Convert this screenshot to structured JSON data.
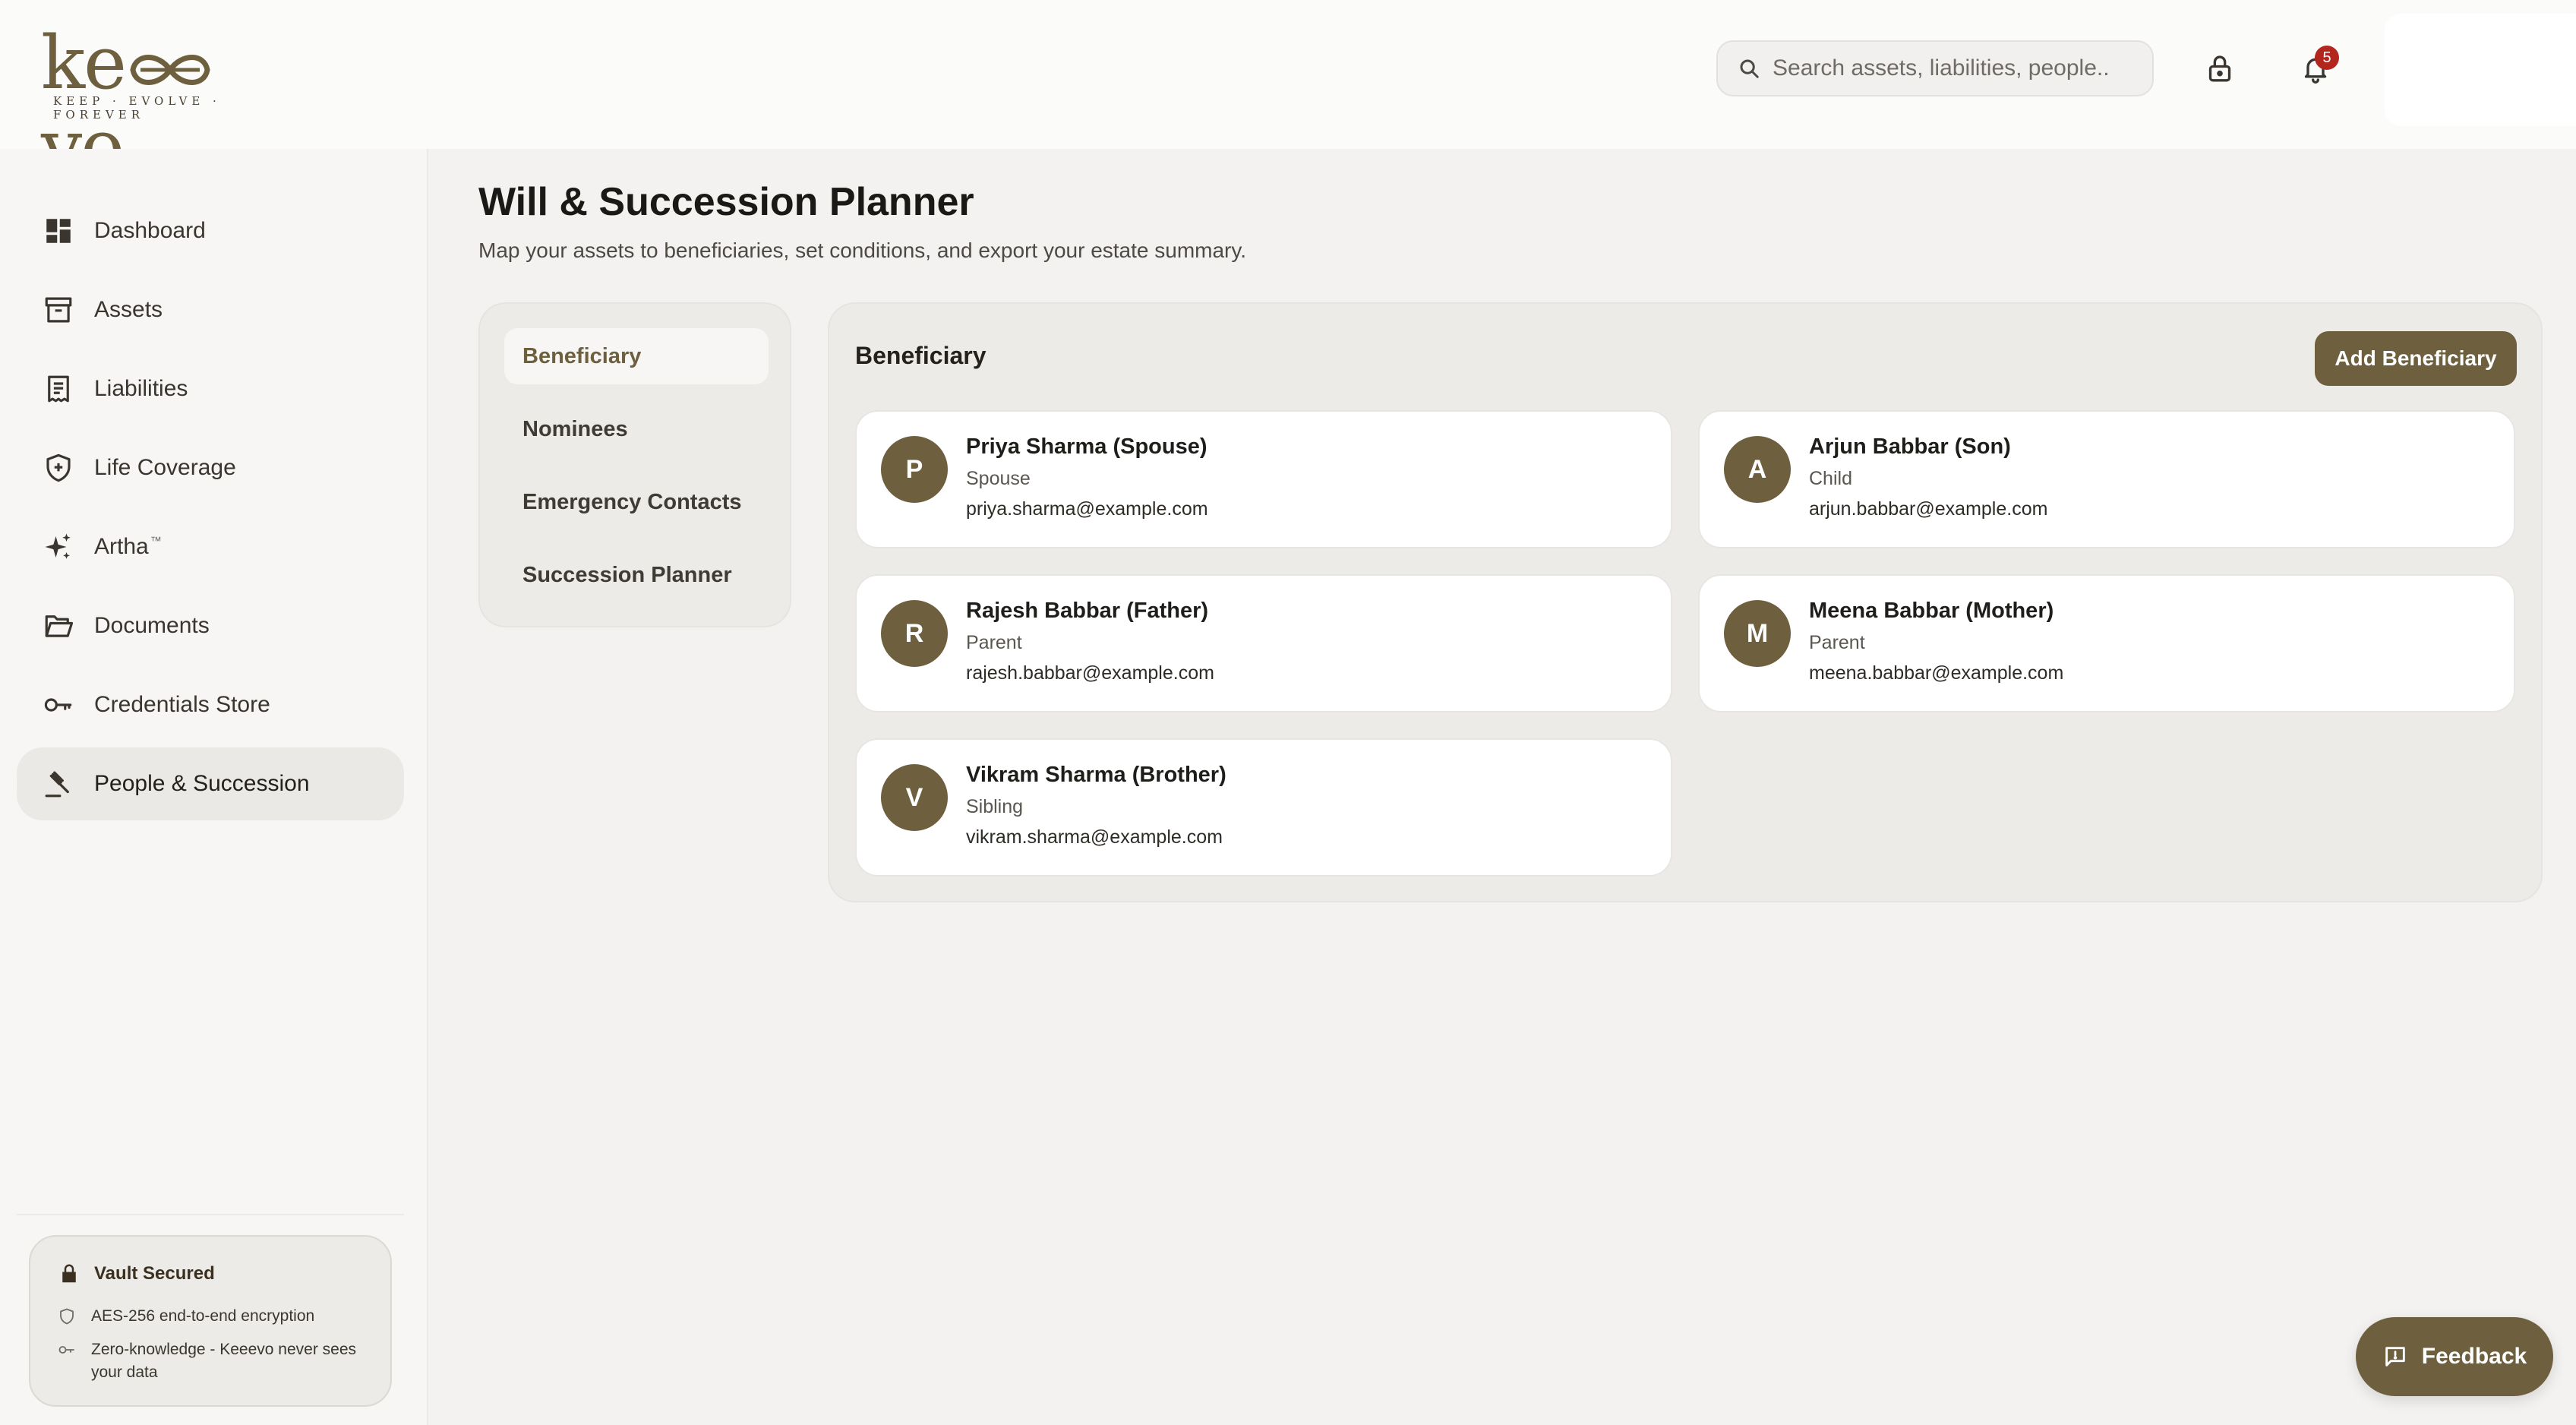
{
  "brand": {
    "logo_text": "keeevo",
    "tagline": "KEEP · EVOLVE · FOREVER",
    "accent_color": "#6e603e"
  },
  "header": {
    "search_placeholder": "Search assets, liabilities, people..",
    "notification_count": "5",
    "icons": [
      "search-icon",
      "lock-icon",
      "bell-icon"
    ]
  },
  "sidebar": {
    "items": [
      {
        "label": "Dashboard",
        "icon": "dashboard-icon",
        "active": false
      },
      {
        "label": "Assets",
        "icon": "archive-box-icon",
        "active": false
      },
      {
        "label": "Liabilities",
        "icon": "receipt-icon",
        "active": false
      },
      {
        "label": "Life Coverage",
        "icon": "shield-plus-icon",
        "active": false
      },
      {
        "label": "Artha",
        "icon": "sparkles-icon",
        "active": false,
        "suffix": "™"
      },
      {
        "label": "Documents",
        "icon": "folder-open-icon",
        "active": false
      },
      {
        "label": "Credentials Store",
        "icon": "key-icon",
        "active": false
      },
      {
        "label": "People & Succession",
        "icon": "gavel-icon",
        "active": true
      }
    ],
    "vault": {
      "title": "Vault Secured",
      "line1": "AES-256 end-to-end encryption",
      "line2": "Zero-knowledge - Keeevo never sees your data"
    }
  },
  "main": {
    "title": "Will & Succession Planner",
    "subtitle": "Map your assets to beneficiaries, set conditions, and export your estate summary.",
    "tabs": [
      {
        "label": "Beneficiary",
        "active": true
      },
      {
        "label": "Nominees",
        "active": false
      },
      {
        "label": "Emergency Contacts",
        "active": false
      },
      {
        "label": "Succession Planner",
        "active": false
      }
    ],
    "panel": {
      "title": "Beneficiary",
      "add_button": "Add Beneficiary",
      "beneficiaries": [
        {
          "initial": "P",
          "name": "Priya Sharma (Spouse)",
          "relation": "Spouse",
          "email": "priya.sharma@example.com"
        },
        {
          "initial": "A",
          "name": "Arjun Babbar (Son)",
          "relation": "Child",
          "email": "arjun.babbar@example.com"
        },
        {
          "initial": "R",
          "name": "Rajesh Babbar (Father)",
          "relation": "Parent",
          "email": "rajesh.babbar@example.com"
        },
        {
          "initial": "M",
          "name": "Meena Babbar (Mother)",
          "relation": "Parent",
          "email": "meena.babbar@example.com"
        },
        {
          "initial": "V",
          "name": "Vikram Sharma (Brother)",
          "relation": "Sibling",
          "email": "vikram.sharma@example.com"
        }
      ]
    }
  },
  "feedback": {
    "label": "Feedback",
    "icon": "message-square-icon"
  }
}
